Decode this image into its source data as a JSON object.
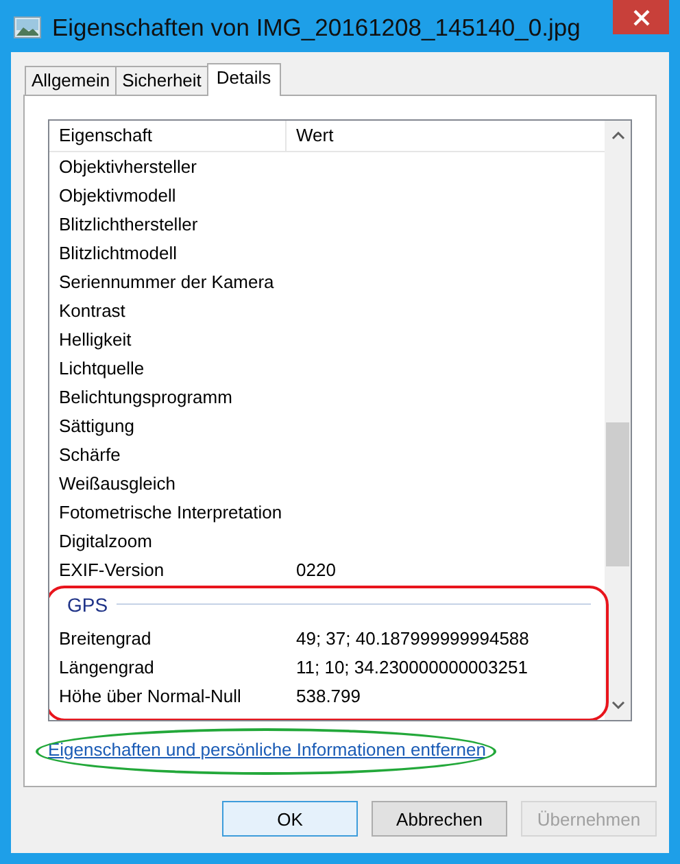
{
  "window": {
    "title": "Eigenschaften von IMG_20161208_145140_0.jpg"
  },
  "tabs": [
    {
      "label": "Allgemein",
      "selected": false
    },
    {
      "label": "Sicherheit",
      "selected": false
    },
    {
      "label": "Details",
      "selected": true
    }
  ],
  "table": {
    "columns": [
      "Eigenschaft",
      "Wert"
    ],
    "rows": [
      {
        "kind": "row",
        "name": "Objektivhersteller"
      },
      {
        "kind": "row",
        "name": "Objektivmodell"
      },
      {
        "kind": "row",
        "name": "Blitzlichthersteller"
      },
      {
        "kind": "row",
        "name": "Blitzlichtmodell"
      },
      {
        "kind": "row",
        "name": "Seriennummer der Kamera"
      },
      {
        "kind": "row",
        "name": "Kontrast"
      },
      {
        "kind": "row",
        "name": "Helligkeit"
      },
      {
        "kind": "row",
        "name": "Lichtquelle"
      },
      {
        "kind": "row",
        "name": "Belichtungsprogramm"
      },
      {
        "kind": "row",
        "name": "Sättigung"
      },
      {
        "kind": "row",
        "name": "Schärfe"
      },
      {
        "kind": "row",
        "name": "Weißausgleich"
      },
      {
        "kind": "row",
        "name": "Fotometrische Interpretation"
      },
      {
        "kind": "row",
        "name": "Digitalzoom"
      },
      {
        "kind": "row",
        "name": "EXIF-Version",
        "value": "0220"
      }
    ],
    "group": {
      "title": "GPS",
      "rows": [
        {
          "name": "Breitengrad",
          "value": "49; 37; 40.187999999994588"
        },
        {
          "name": "Längengrad",
          "value": "11; 10; 34.230000000003251"
        },
        {
          "name": "Höhe über Normal-Null",
          "value": "538.799"
        }
      ]
    }
  },
  "link": "Eigenschaften und persönliche Informationen entfernen",
  "buttons": [
    {
      "label": "OK",
      "disabled": false,
      "default": true
    },
    {
      "label": "Abbrechen",
      "disabled": false,
      "default": false
    },
    {
      "label": "Übernehmen",
      "disabled": true,
      "default": false
    }
  ]
}
